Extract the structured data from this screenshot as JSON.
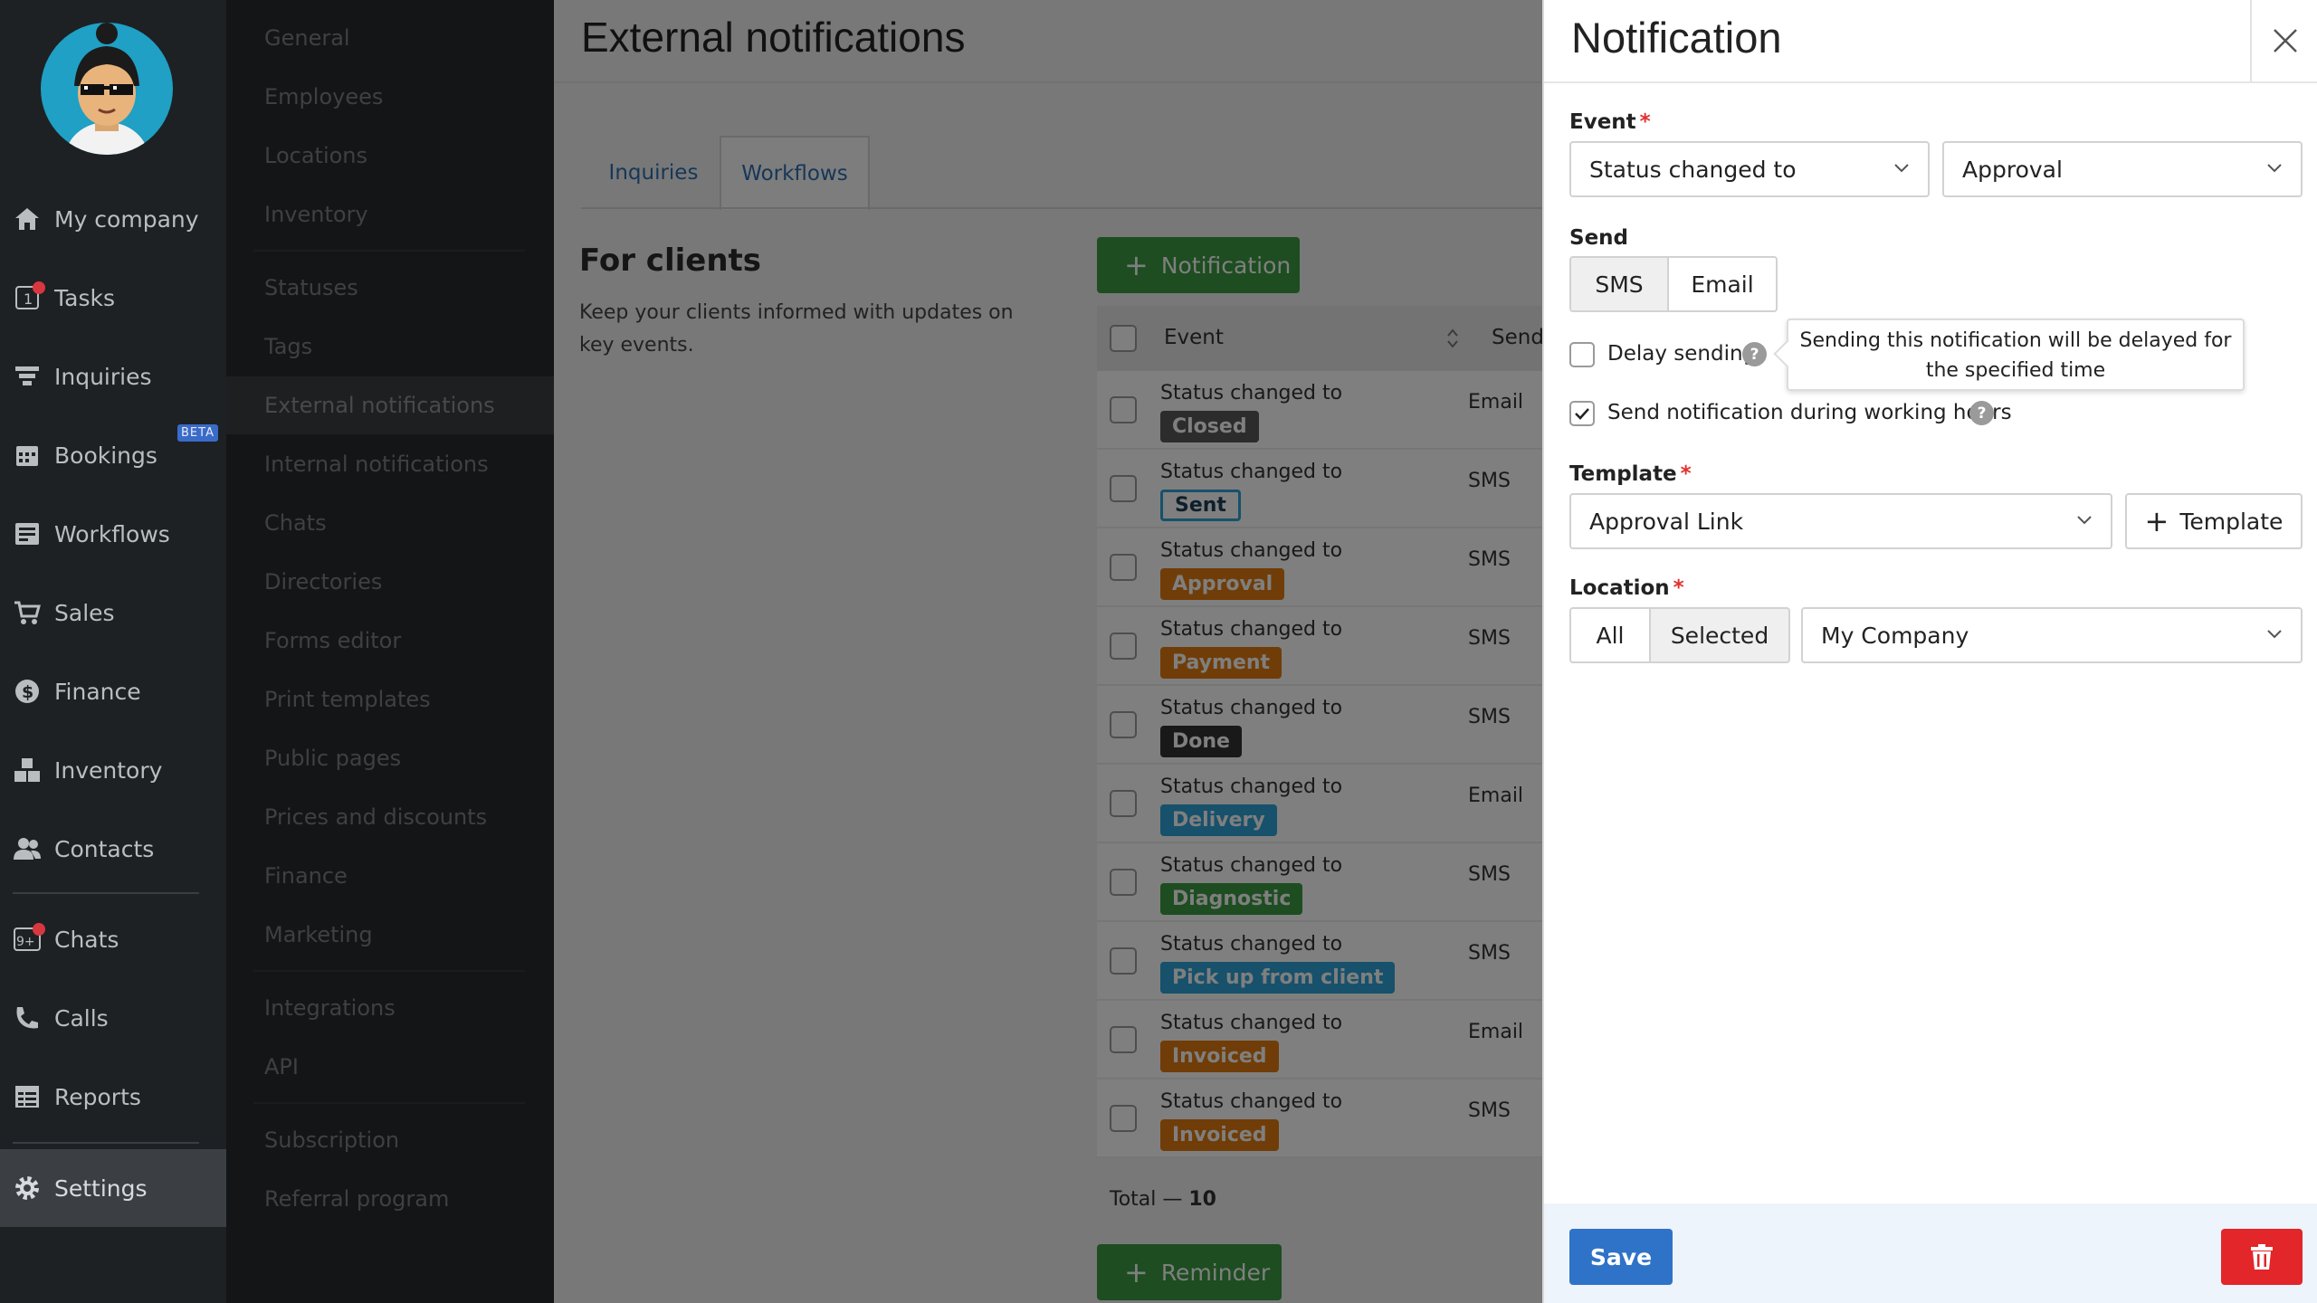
{
  "nav": {
    "items": [
      {
        "label": "My company",
        "icon": "home-icon"
      },
      {
        "label": "Tasks",
        "icon": "tasks-icon",
        "badge": "1"
      },
      {
        "label": "Inquiries",
        "icon": "funnel-icon"
      },
      {
        "label": "Bookings",
        "icon": "calendar-icon",
        "tag": "BETA"
      },
      {
        "label": "Workflows",
        "icon": "workflow-icon"
      },
      {
        "label": "Sales",
        "icon": "cart-icon"
      },
      {
        "label": "Finance",
        "icon": "dollar-icon"
      },
      {
        "label": "Inventory",
        "icon": "boxes-icon"
      },
      {
        "label": "Contacts",
        "icon": "people-icon"
      },
      {
        "label": "Chats",
        "icon": "chat-icon",
        "badge": "9+"
      },
      {
        "label": "Calls",
        "icon": "phone-icon"
      },
      {
        "label": "Reports",
        "icon": "reports-icon"
      },
      {
        "label": "Settings",
        "icon": "gear-icon"
      }
    ]
  },
  "settings_menu": [
    "General",
    "Employees",
    "Locations",
    "Inventory",
    "Statuses",
    "Tags",
    "External notifications",
    "Internal notifications",
    "Chats",
    "Directories",
    "Forms editor",
    "Print templates",
    "Public pages",
    "Prices and discounts",
    "Finance",
    "Marketing",
    "Integrations",
    "API",
    "Subscription",
    "Referral program"
  ],
  "main": {
    "title": "External notifications",
    "tabs": [
      "Inquiries",
      "Workflows"
    ],
    "section_title": "For clients",
    "section_desc": "Keep your clients informed with updates on key events.",
    "add_notification": "Notification",
    "add_reminder": "Reminder",
    "table": {
      "headers": [
        "Event",
        "Send"
      ],
      "rows": [
        {
          "event": "Status changed to",
          "status": "Closed",
          "color": "#595959",
          "send": "Email"
        },
        {
          "event": "Status changed to",
          "status": "Sent",
          "color": "outline",
          "send": "SMS"
        },
        {
          "event": "Status changed to",
          "status": "Approval",
          "color": "#e07a10",
          "send": "SMS"
        },
        {
          "event": "Status changed to",
          "status": "Payment",
          "color": "#e07a10",
          "send": "SMS"
        },
        {
          "event": "Status changed to",
          "status": "Done",
          "color": "#333333",
          "send": "SMS"
        },
        {
          "event": "Status changed to",
          "status": "Delivery",
          "color": "#2ea2d6",
          "send": "Email"
        },
        {
          "event": "Status changed to",
          "status": "Diagnostic",
          "color": "#3b9a41",
          "send": "SMS"
        },
        {
          "event": "Status changed to",
          "status": "Pick up from client",
          "color": "#2ea2d6",
          "send": "SMS"
        },
        {
          "event": "Status changed to",
          "status": "Invoiced",
          "color": "#e07a10",
          "send": "Email"
        },
        {
          "event": "Status changed to",
          "status": "Invoiced",
          "color": "#e07a10",
          "send": "SMS"
        }
      ],
      "total_label": "Total —",
      "total_value": "10"
    }
  },
  "drawer": {
    "title": "Notification",
    "event_label": "Event",
    "event_type": "Status changed to",
    "event_status": "Approval",
    "send_label": "Send",
    "send_options": [
      "SMS",
      "Email"
    ],
    "send_selected": "SMS",
    "delay_label": "Delay sending",
    "delay_checked": false,
    "tooltip": "Sending this notification will be delayed for the specified time",
    "working_hours_label": "Send notification during working hours",
    "working_hours_checked": true,
    "template_label": "Template",
    "template_value": "Approval Link",
    "add_template": "Template",
    "location_label": "Location",
    "location_options": [
      "All",
      "Selected"
    ],
    "location_selected": "Selected",
    "location_value": "My Company",
    "save": "Save",
    "colors": {
      "accent": "#2f73c9",
      "danger": "#e2262a",
      "green": "#3b9a41"
    }
  }
}
